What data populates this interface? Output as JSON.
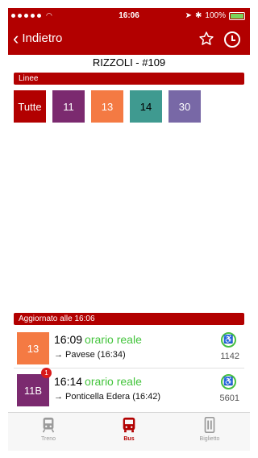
{
  "status_bar": {
    "time": "16:06",
    "battery": "100%"
  },
  "nav": {
    "back_label": "Indietro"
  },
  "stop": {
    "title": "RIZZOLI - #109"
  },
  "lines_section": {
    "label": "Linee",
    "tiles": [
      {
        "label": "Tutte",
        "color": "#b20000"
      },
      {
        "label": "11",
        "color": "#7b2a6f"
      },
      {
        "label": "13",
        "color": "#f47a43"
      },
      {
        "label": "14",
        "color": "#3f9a90"
      },
      {
        "label": "30",
        "color": "#7868a6"
      }
    ]
  },
  "updated": {
    "label": "Aggiornato alle 16:06"
  },
  "arrivals": [
    {
      "line": "13",
      "color": "#f47a43",
      "time": "16:09",
      "realtime_label": "orario reale",
      "destination": "→ Pavese (16:34)",
      "bus_id": "1142",
      "notification": ""
    },
    {
      "line": "11B",
      "color": "#7b2a6f",
      "time": "16:14",
      "realtime_label": "orario reale",
      "destination": "→ Ponticella Edera (16:42)",
      "bus_id": "5601",
      "notification": "1"
    }
  ],
  "tabs": [
    {
      "label": "Treno",
      "icon": "train-icon",
      "active": false
    },
    {
      "label": "Bus",
      "icon": "bus-icon",
      "active": true
    },
    {
      "label": "Biglietto",
      "icon": "ticket-icon",
      "active": false
    }
  ],
  "colors": {
    "brand": "#b20000",
    "realtime": "#43c43c",
    "accessible": "#45c040"
  }
}
